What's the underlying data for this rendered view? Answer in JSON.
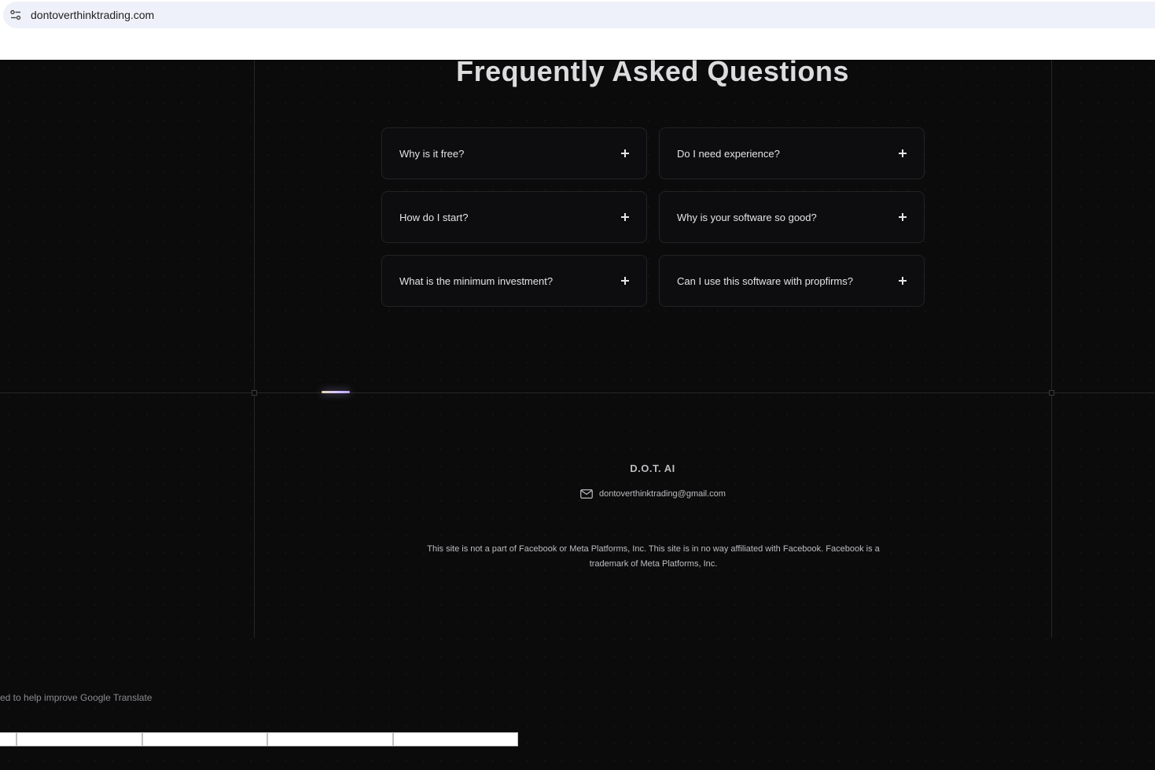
{
  "browser": {
    "url": "dontoverthinktrading.com"
  },
  "faq": {
    "title": "Frequently Asked Questions",
    "items": [
      {
        "question": "Why is it free?"
      },
      {
        "question": "Do I need experience?"
      },
      {
        "question": "How do I start?"
      },
      {
        "question": "Why is your software so good?"
      },
      {
        "question": "What is the minimum investment?"
      },
      {
        "question": "Can I use this software with propfirms?"
      }
    ]
  },
  "footer": {
    "brand": "D.O.T. AI",
    "email": "dontoverthinktrading@gmail.com",
    "disclaimer": "This site is not a part of Facebook or Meta Platforms, Inc. This site is in no way affiliated with Facebook. Facebook is a trademark of Meta Platforms, Inc."
  },
  "translate": {
    "partial_text": "ed to help improve Google Translate"
  }
}
